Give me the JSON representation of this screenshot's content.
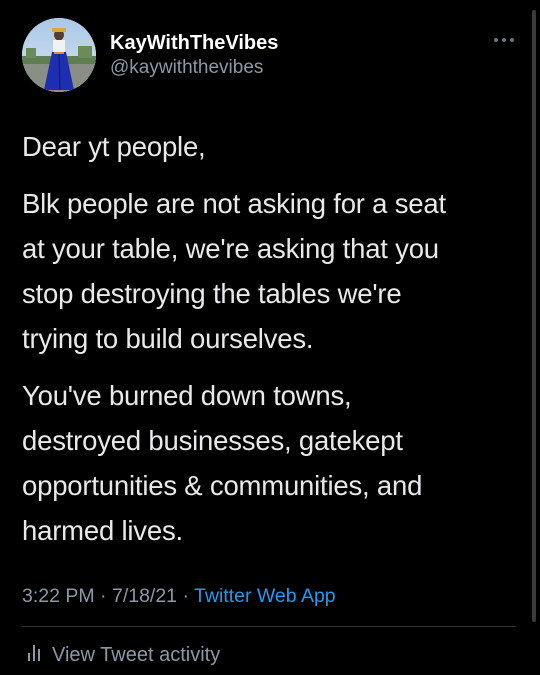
{
  "author": {
    "display_name": "KayWithTheVibes",
    "handle": "@kaywiththevibes",
    "avatar_icon": "profile-photo-icon"
  },
  "tweet": {
    "paragraphs": [
      {
        "lines": [
          "Dear yt people,"
        ]
      },
      {
        "lines": [
          "Blk people are not asking for a seat",
          "at your table, we're asking that you",
          "stop destroying the tables we're",
          "trying to build ourselves."
        ]
      },
      {
        "lines": [
          "You've burned down towns,",
          "destroyed businesses, gatekept",
          "opportunities & communities, and",
          "harmed lives."
        ]
      }
    ]
  },
  "meta": {
    "time": "3:22 PM",
    "separator": "·",
    "date": "7/18/21",
    "source": "Twitter Web App"
  },
  "activity": {
    "label": "View Tweet activity",
    "icon": "analytics-bars-icon"
  },
  "colors": {
    "background": "#000000",
    "text": "#e7e9ea",
    "secondary": "#8b98a5",
    "link": "#1d9bf0",
    "divider": "#2f3336"
  }
}
